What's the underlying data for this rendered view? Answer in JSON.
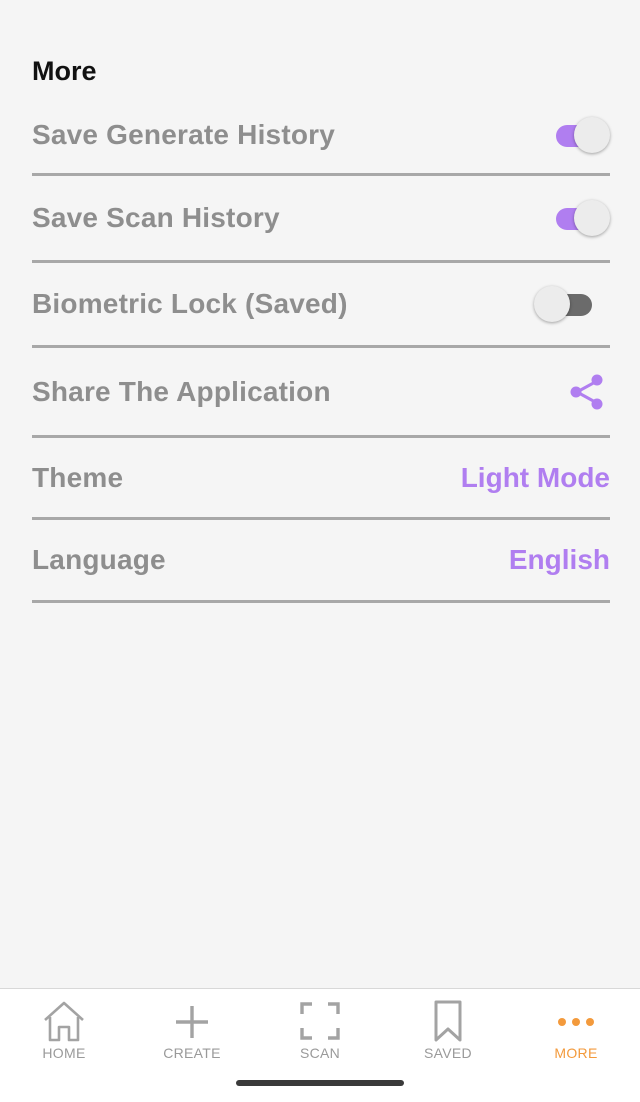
{
  "page": {
    "title": "More"
  },
  "settings": [
    {
      "label": "Save Generate History",
      "control": "toggle",
      "on": true
    },
    {
      "label": "Save Scan History",
      "control": "toggle",
      "on": true
    },
    {
      "label": "Biometric Lock (Saved)",
      "control": "toggle",
      "on": false
    },
    {
      "label": "Share The Application",
      "control": "icon",
      "icon": "share-icon"
    },
    {
      "label": "Theme",
      "control": "value",
      "value": "Light Mode"
    },
    {
      "label": "Language",
      "control": "value",
      "value": "English"
    }
  ],
  "nav": {
    "items": [
      {
        "label": "HOME",
        "icon": "home-icon",
        "active": false
      },
      {
        "label": "CREATE",
        "icon": "plus-icon",
        "active": false
      },
      {
        "label": "SCAN",
        "icon": "scan-frame-icon",
        "active": false
      },
      {
        "label": "SAVED",
        "icon": "bookmark-icon",
        "active": false
      },
      {
        "label": "MORE",
        "icon": "more-dots-icon",
        "active": true
      }
    ]
  },
  "colors": {
    "accent": "#b07ef0",
    "nav_active": "#f39a3c",
    "label_gray": "#8e8e8e",
    "background": "#f5f5f5"
  }
}
